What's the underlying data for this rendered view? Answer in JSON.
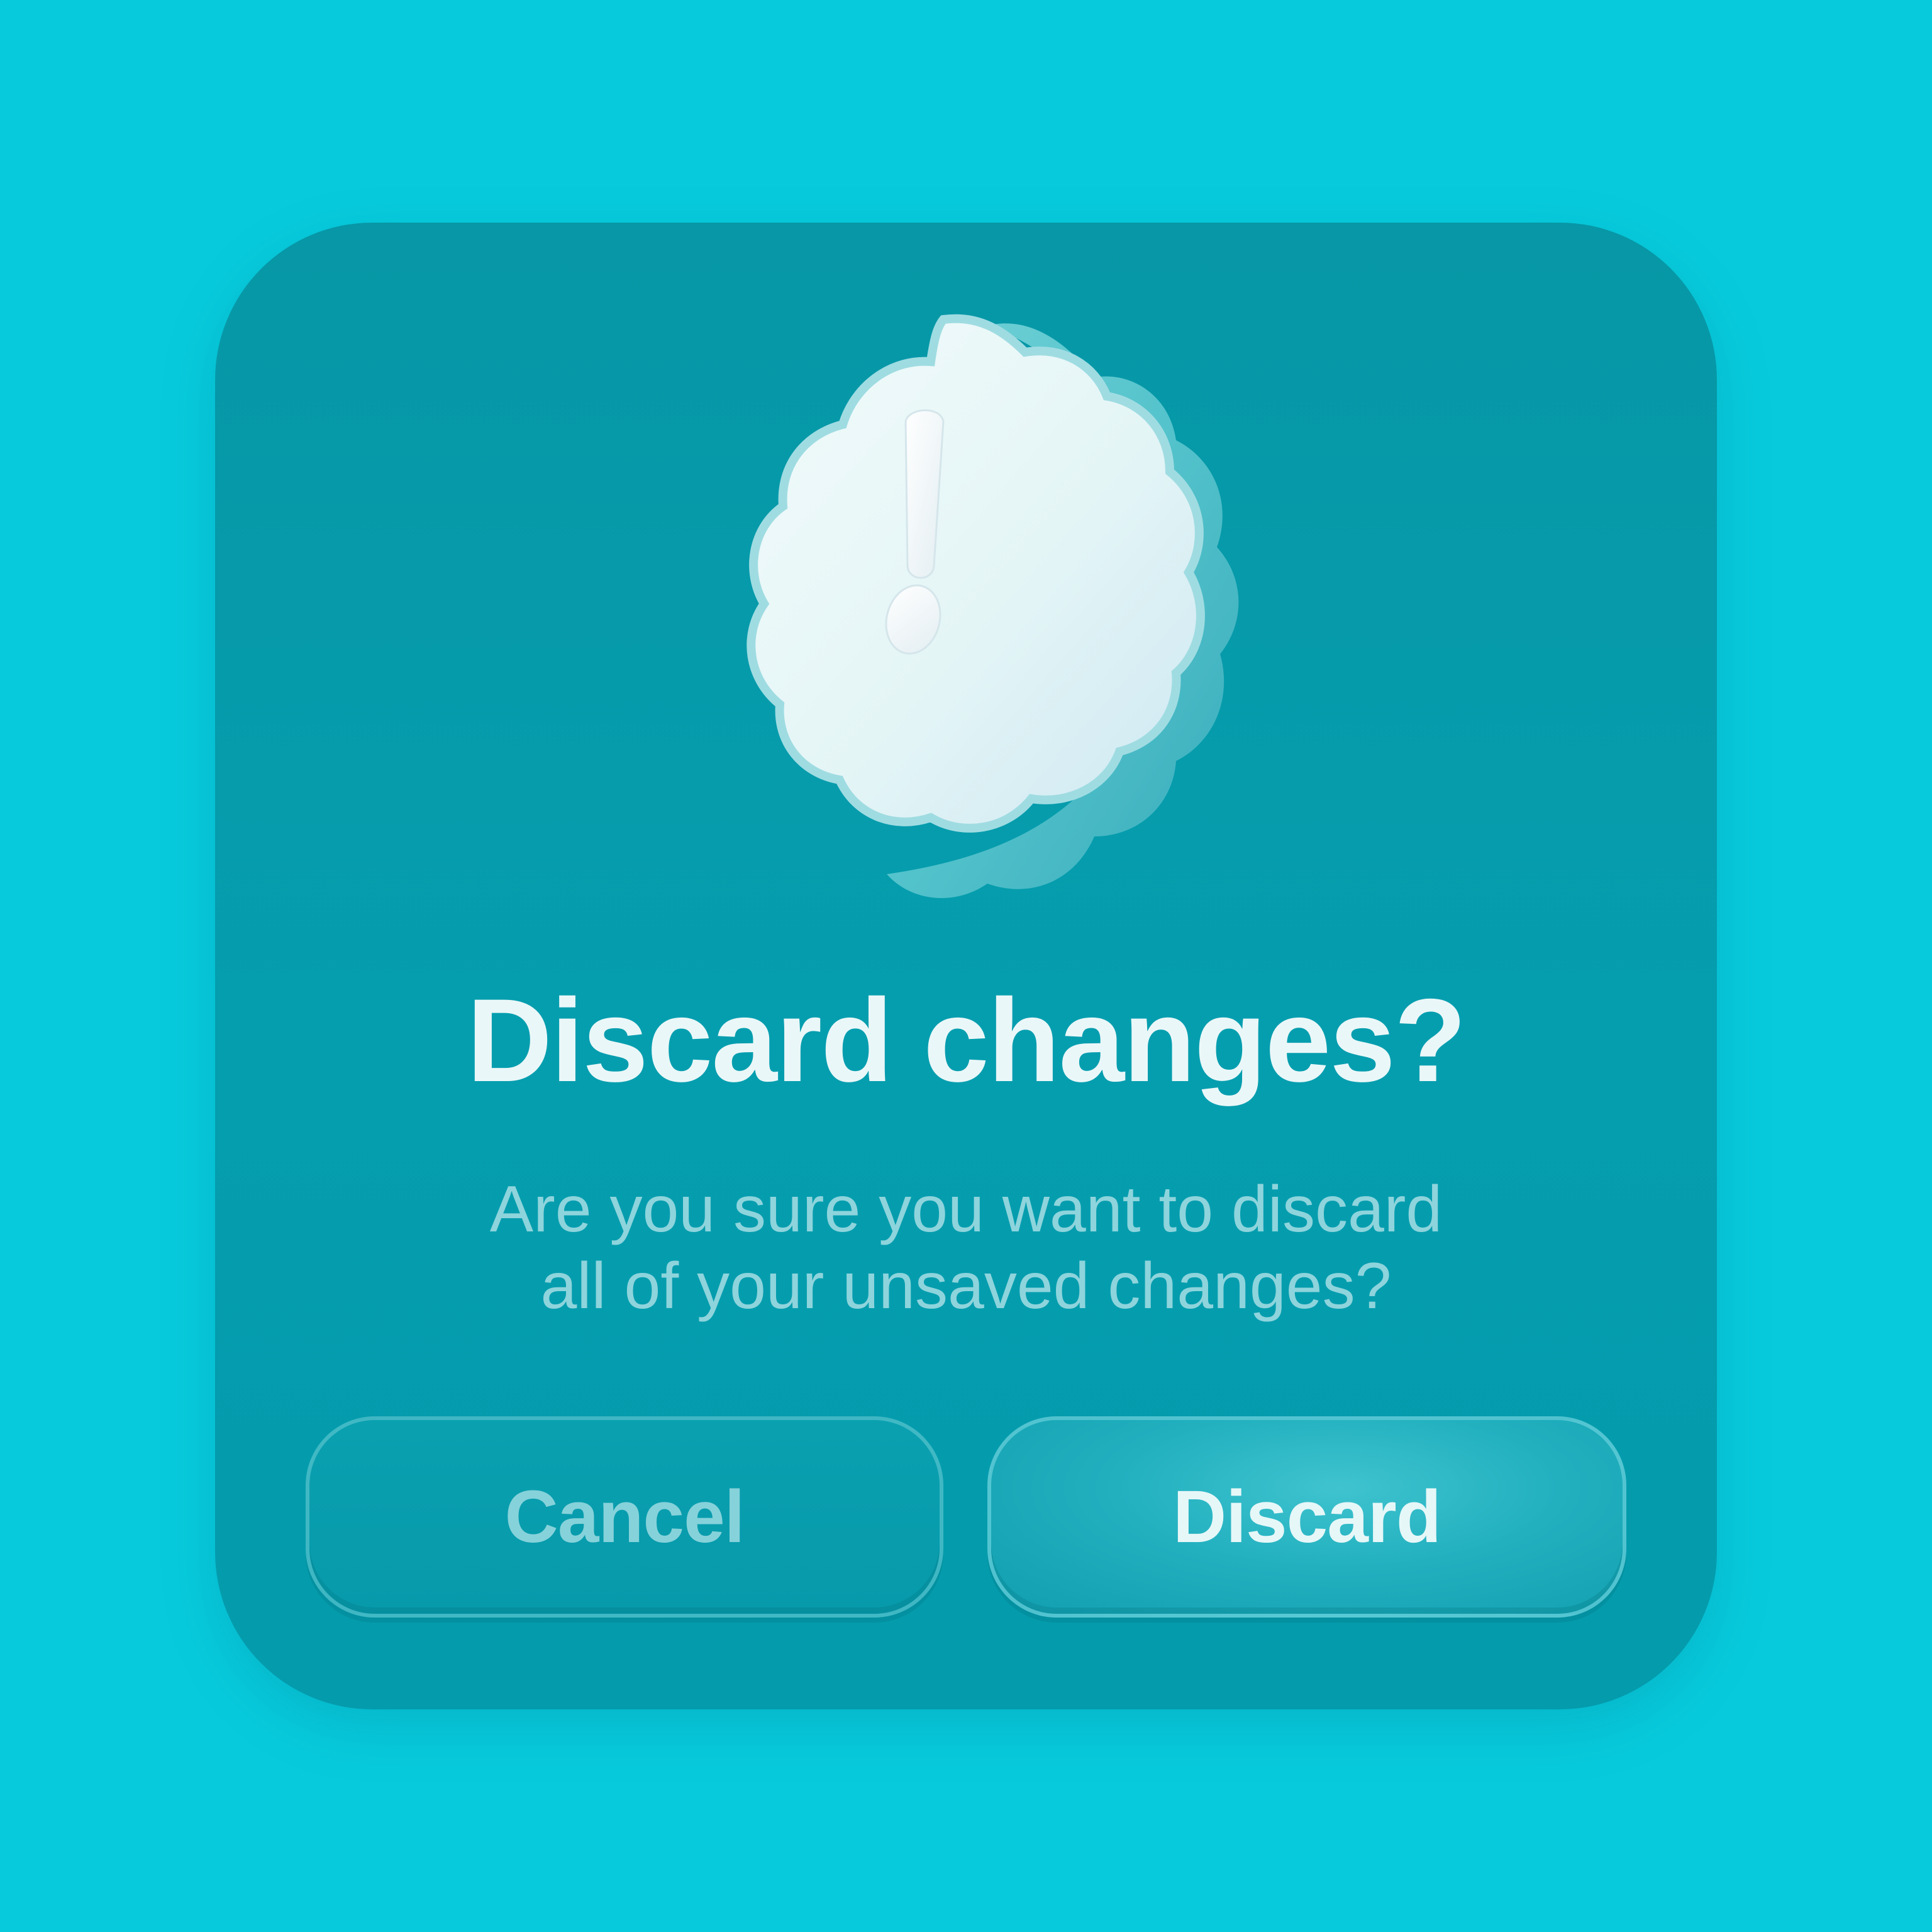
{
  "dialog": {
    "title": "Discard changes?",
    "message_line1": "Are you sure you want to discard",
    "message_line2": "all of your unsaved changes?",
    "icon": "exclamation-badge-icon"
  },
  "buttons": {
    "cancel_label": "Cancel",
    "discard_label": "Discard"
  },
  "colors": {
    "background": "#07CBDD",
    "dialog": "#059EAF",
    "title_text": "#EAF7F8",
    "message_text": "#8ED4DC",
    "cancel_text": "#86D2DA",
    "discard_text": "#E6F7F8"
  }
}
